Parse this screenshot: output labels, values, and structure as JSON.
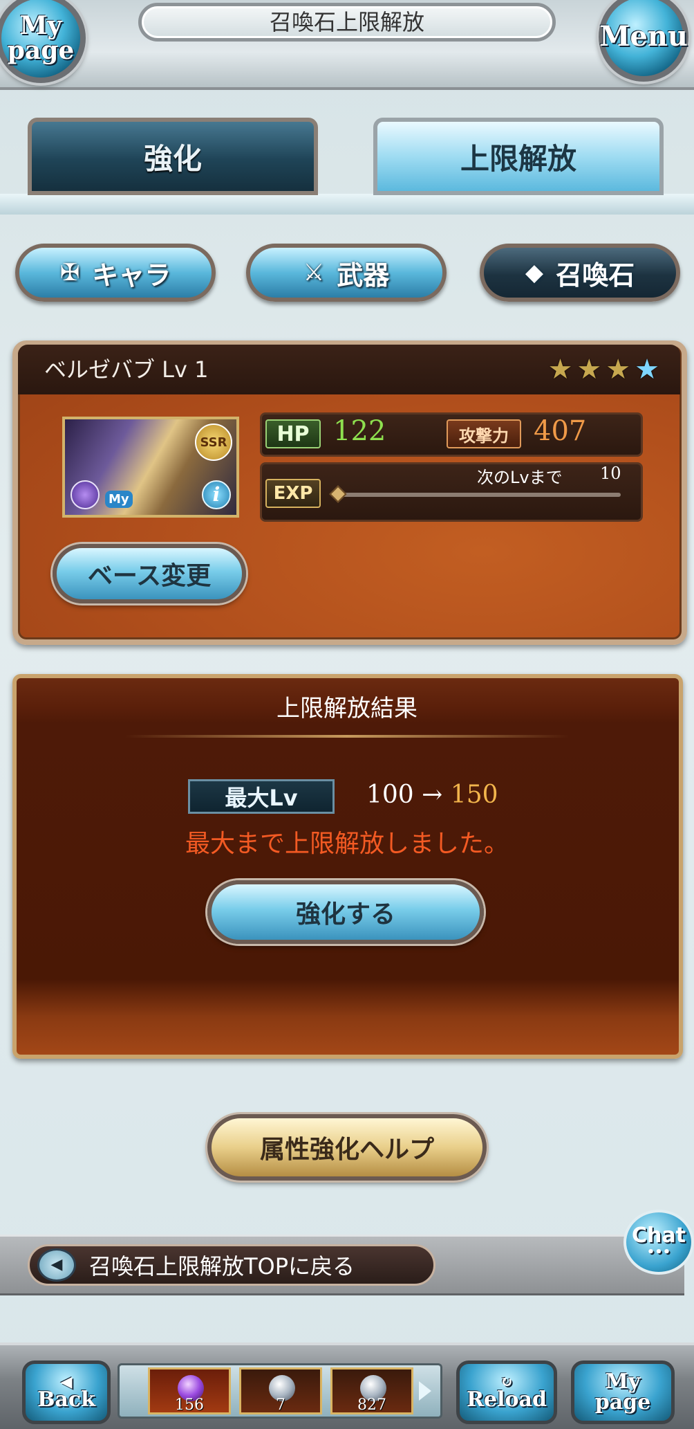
{
  "header": {
    "title": "召喚石上限解放",
    "mypage_label": "My page",
    "menu_label": "Menu"
  },
  "tabs": [
    {
      "label": "強化",
      "active": false
    },
    {
      "label": "上限解放",
      "active": true
    }
  ],
  "categories": [
    {
      "label": "キャラ",
      "icon": "chara-icon"
    },
    {
      "label": "武器",
      "icon": "weapon-icon"
    },
    {
      "label": "召喚石",
      "icon": "summon-stone-icon",
      "selected": true
    }
  ],
  "summon": {
    "name_level": "ベルゼバブ Lv 1",
    "stars_total": 4,
    "stars_uncap_blue": 1,
    "rarity": "SSR",
    "my_badge": "My",
    "hp_label": "HP",
    "hp_value": "122",
    "atk_label": "攻撃力",
    "atk_value": "407",
    "exp_label": "EXP",
    "next_label": "次のLvまで",
    "next_value": "10",
    "base_change_label": "ベース変更"
  },
  "result": {
    "title": "上限解放結果",
    "max_lv_label": "最大Lv",
    "from": "100",
    "arrow": "→",
    "to": "150",
    "message": "最大まで上限解放しました。",
    "enhance_button": "強化する"
  },
  "help_button": "属性強化ヘルプ",
  "back_link": "召喚石上限解放TOPに戻る",
  "chat_label": "Chat",
  "footer": {
    "back_label": "Back",
    "reload_label": "Reload",
    "mypage_label": "My page",
    "items": [
      {
        "count": "156",
        "icon": "purple-orb-icon"
      },
      {
        "count": "7",
        "icon": "silver-orb-icon"
      },
      {
        "count": "827",
        "icon": "silver-orb-icon"
      }
    ]
  },
  "colors": {
    "hp": "#8ee04f",
    "atk": "#f09a48",
    "message": "#f35a23",
    "panel": "#b14f1c"
  }
}
